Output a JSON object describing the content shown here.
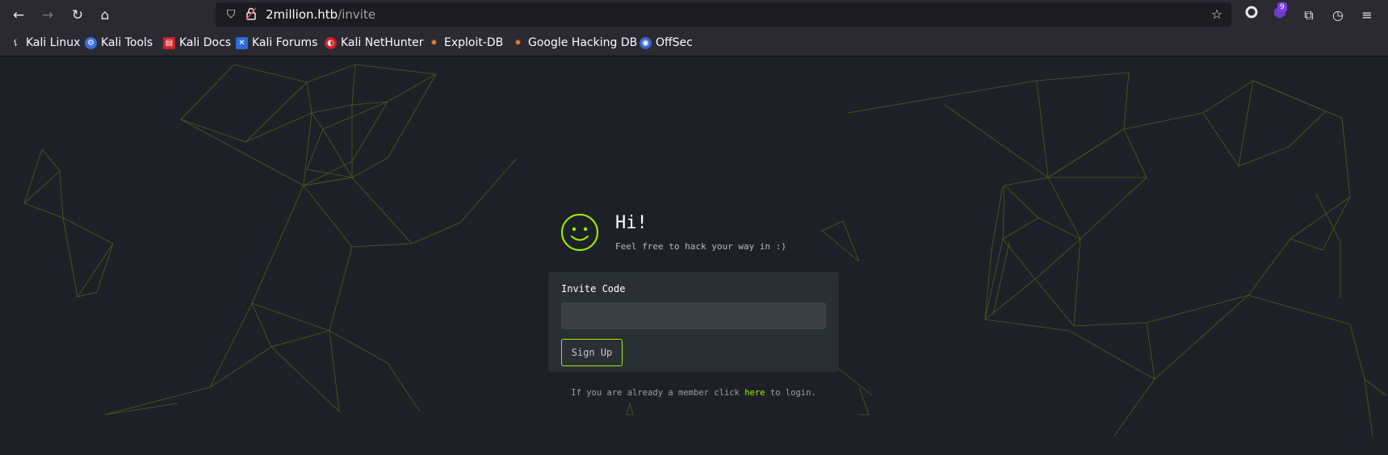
{
  "browser": {
    "url_host": "2million.htb",
    "url_path": "/invite",
    "notification_count": "9",
    "bookmarks": [
      {
        "label": "Kali Linux",
        "icon": "kali-dragon-icon"
      },
      {
        "label": "Kali Tools",
        "icon": "kali-tools-icon"
      },
      {
        "label": "Kali Docs",
        "icon": "kali-docs-icon"
      },
      {
        "label": "Kali Forums",
        "icon": "kali-forums-icon"
      },
      {
        "label": "Kali NetHunter",
        "icon": "kali-nethunter-icon"
      },
      {
        "label": "Exploit-DB",
        "icon": "exploit-db-icon"
      },
      {
        "label": "Google Hacking DB",
        "icon": "ghdb-icon"
      },
      {
        "label": "OffSec",
        "icon": "offsec-icon"
      }
    ]
  },
  "page": {
    "heading": "Hi!",
    "subheading": "Feel free to hack your way in :)",
    "invite_label": "Invite Code",
    "invite_value": "",
    "signup_label": "Sign Up",
    "footer_prefix": "If you are already a member click ",
    "footer_link": "here",
    "footer_suffix": " to login."
  },
  "colors": {
    "accent": "#9fef00",
    "background": "#1d2127",
    "card": "#2a2e35"
  }
}
